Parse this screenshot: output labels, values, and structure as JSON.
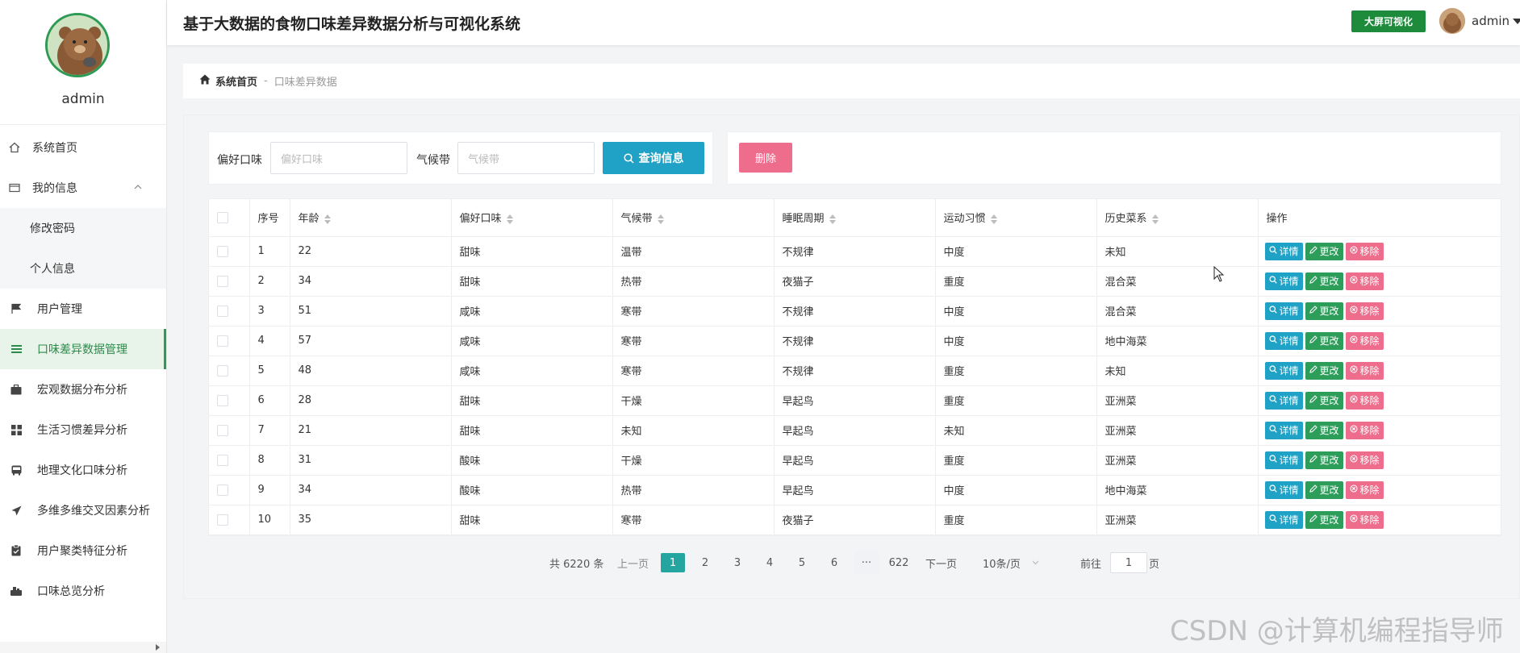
{
  "app": {
    "title": "基于大数据的食物口味差异数据分析与可视化系统",
    "bigscreen_label": "大屏可视化",
    "user": "admin"
  },
  "sidebar": {
    "profile_name": "admin",
    "items": [
      {
        "label": "系统首页",
        "icon": "home-icon"
      },
      {
        "label": "我的信息",
        "icon": "id-card-icon"
      },
      {
        "label": "修改密码",
        "icon": ""
      },
      {
        "label": "个人信息",
        "icon": ""
      },
      {
        "label": "用户管理",
        "icon": "flag-icon"
      },
      {
        "label": "口味差异数据管理",
        "icon": "list-icon"
      },
      {
        "label": "宏观数据分布分析",
        "icon": "briefcase-icon"
      },
      {
        "label": "生活习惯差异分析",
        "icon": "grid-icon"
      },
      {
        "label": "地理文化口味分析",
        "icon": "bus-icon"
      },
      {
        "label": "多维多维交叉因素分析",
        "icon": "send-icon"
      },
      {
        "label": "用户聚类特征分析",
        "icon": "clipboard-icon"
      },
      {
        "label": "口味总览分析",
        "icon": "dashboard-icon"
      }
    ]
  },
  "breadcrumb": {
    "home": "系统首页",
    "sep": "-",
    "current": "口味差异数据"
  },
  "search": {
    "taste_label": "偏好口味",
    "taste_placeholder": "偏好口味",
    "climate_label": "气候带",
    "climate_placeholder": "气候带",
    "query_label": "查询信息",
    "delete_label": "删除"
  },
  "table": {
    "headers": [
      "序号",
      "年龄",
      "偏好口味",
      "气候带",
      "睡眠周期",
      "运动习惯",
      "历史菜系",
      "操作"
    ],
    "actions": {
      "detail": "详情",
      "edit": "更改",
      "remove": "移除"
    },
    "rows": [
      [
        "1",
        "22",
        "甜味",
        "温带",
        "不规律",
        "中度",
        "未知"
      ],
      [
        "2",
        "34",
        "甜味",
        "热带",
        "夜猫子",
        "重度",
        "混合菜"
      ],
      [
        "3",
        "51",
        "咸味",
        "寒带",
        "不规律",
        "中度",
        "混合菜"
      ],
      [
        "4",
        "57",
        "咸味",
        "寒带",
        "不规律",
        "中度",
        "地中海菜"
      ],
      [
        "5",
        "48",
        "咸味",
        "寒带",
        "不规律",
        "重度",
        "未知"
      ],
      [
        "6",
        "28",
        "甜味",
        "干燥",
        "早起鸟",
        "重度",
        "亚洲菜"
      ],
      [
        "7",
        "21",
        "甜味",
        "未知",
        "早起鸟",
        "未知",
        "亚洲菜"
      ],
      [
        "8",
        "31",
        "酸味",
        "干燥",
        "早起鸟",
        "重度",
        "亚洲菜"
      ],
      [
        "9",
        "34",
        "酸味",
        "热带",
        "早起鸟",
        "中度",
        "地中海菜"
      ],
      [
        "10",
        "35",
        "甜味",
        "寒带",
        "夜猫子",
        "重度",
        "亚洲菜"
      ]
    ]
  },
  "pagination": {
    "total": "共 6220 条",
    "prev": "上一页",
    "pages": [
      "1",
      "2",
      "3",
      "4",
      "5",
      "6"
    ],
    "more": "···",
    "last": "622",
    "next": "下一页",
    "page_size": "10条/页",
    "goto_label": "前往",
    "goto_value": "1",
    "page_suffix": "页"
  },
  "watermark": "CSDN @计算机编程指导师",
  "colors": {
    "accent_green": "#2e9b55",
    "teal": "#1fa2c5",
    "pink": "#ef6d8c",
    "bigscreen_green": "#1e8a3c"
  }
}
